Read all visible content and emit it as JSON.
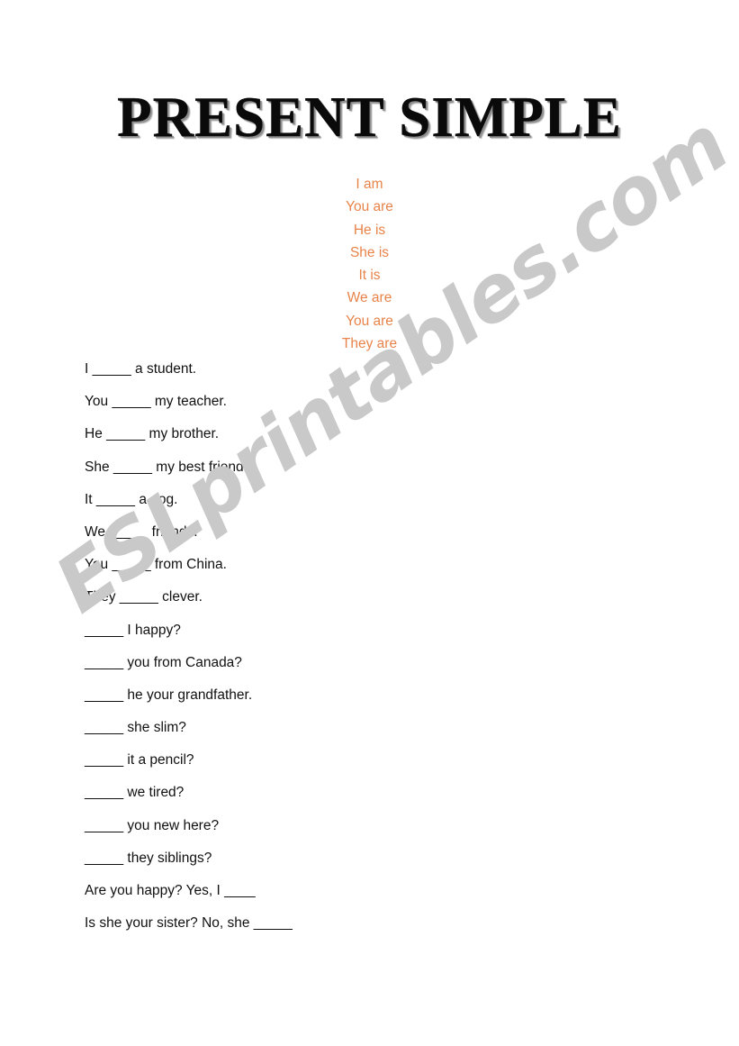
{
  "document": {
    "title": "PRESENT SIMPLE",
    "watermark": "ESLprintables.com",
    "accent_color": "#E8834A",
    "text_color": "#111111",
    "watermark_color": "#C9C9C9",
    "background_color": "#FFFFFF"
  },
  "verb_table": {
    "lines": [
      "I am",
      "You are",
      "He is",
      "She is",
      "It is",
      "We are",
      "You are",
      "They are"
    ]
  },
  "exercises": {
    "lines": [
      "I _____ a student.",
      "You _____ my teacher.",
      "He _____ my brother.",
      "She _____ my best friend.",
      "It _____ a dog.",
      "We _____ friends.",
      "You _____ from China.",
      "They _____ clever.",
      "_____ I happy?",
      "_____ you from Canada?",
      "_____ he your grandfather.",
      "_____ she slim?",
      "_____ it a pencil?",
      "_____ we tired?",
      "_____ you new here?",
      "_____ they siblings?",
      "Are you happy? Yes, I ____",
      "Is she your sister? No, she _____"
    ]
  }
}
